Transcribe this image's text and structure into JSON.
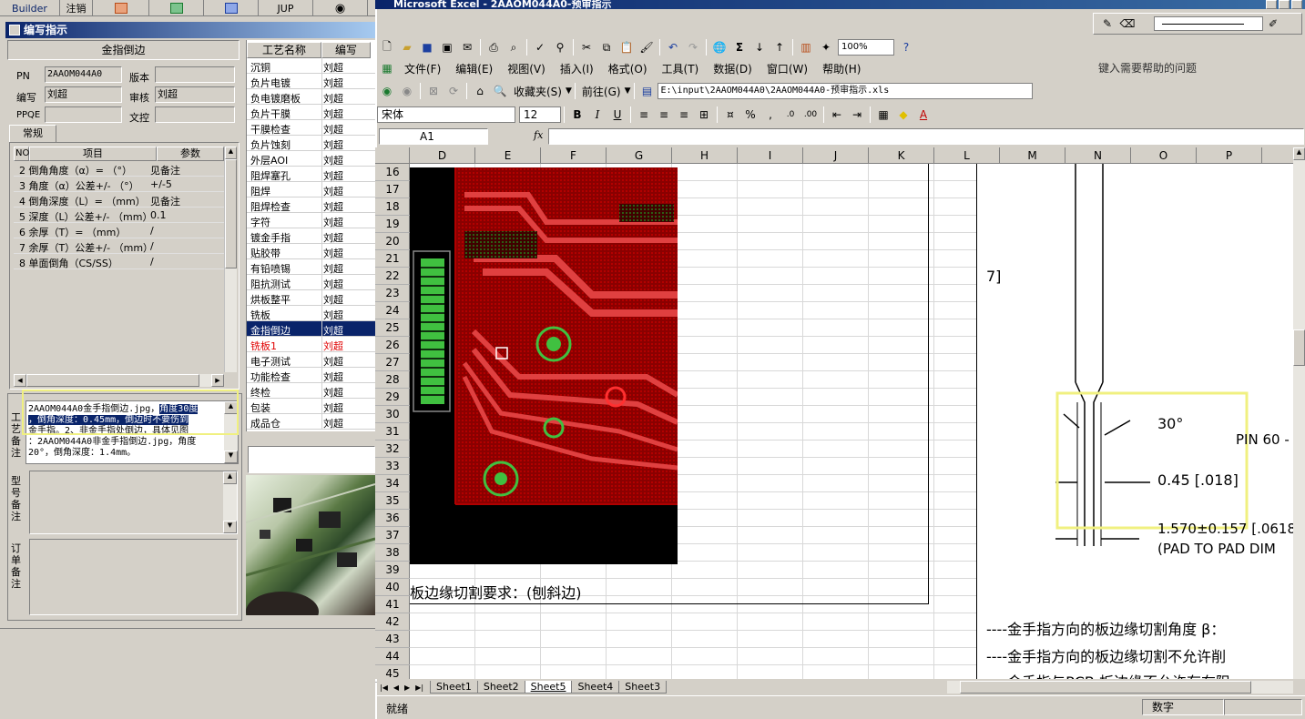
{
  "app_toolbar": {
    "builder": "Builder",
    "logout": "注销",
    "jup": "JUP"
  },
  "dialog": {
    "title": "编写指示",
    "section_title": "金指倒边",
    "labels": {
      "pn": "PN",
      "version": "版本",
      "writer": "编写",
      "reviewer": "审核",
      "ppqe": "PPQE",
      "docctrl": "文控"
    },
    "values": {
      "pn": "2AAOM044A0",
      "version": "",
      "writer": "刘超",
      "reviewer": "刘超",
      "ppqe": "",
      "docctrl": ""
    },
    "tab": "常规",
    "param_headers": [
      "NO",
      "项目",
      "参数"
    ],
    "params": [
      {
        "item": "2 倒角角度（α）=  （°）",
        "value": "见备注"
      },
      {
        "item": "3 角度（α）公差+/-  （°）",
        "value": "+/-5"
      },
      {
        "item": "4 倒角深度（L）=  （mm）",
        "value": "见备注"
      },
      {
        "item": "5 深度（L）公差+/-  （mm）",
        "value": "0.1"
      },
      {
        "item": "6 余厚（T）=  （mm）",
        "value": "/"
      },
      {
        "item": "7 余厚（T）公差+/-  （mm）",
        "value": "/"
      },
      {
        "item": "8 单面倒角（CS/SS）",
        "value": "/"
      }
    ],
    "note_labels": {
      "process": "工艺备注",
      "model": "型号备注",
      "order": "订单备注"
    },
    "process_note": {
      "sel1": "2AAOM044A0金手指倒边.jpg，",
      "sel2": "角度30度",
      "sel3": "，倒角深度：0.45mm，",
      "sel4": "倒边时不要伤到",
      "line3": "金手指。2、非金手指处倒边，具体见图",
      "line4": "：2AAOM044A0非金手指倒边.jpg，角度",
      "line5": "20°，倒角深度：1.4mm。"
    }
  },
  "process_list": {
    "headers": [
      "工艺名称",
      "编写"
    ],
    "rows": [
      {
        "name": "沉铜",
        "writer": "刘超"
      },
      {
        "name": "负片电镀",
        "writer": "刘超"
      },
      {
        "name": "负电镀磨板",
        "writer": "刘超"
      },
      {
        "name": "负片干膜",
        "writer": "刘超"
      },
      {
        "name": "干膜检查",
        "writer": "刘超"
      },
      {
        "name": "负片蚀刻",
        "writer": "刘超"
      },
      {
        "name": "外层AOI",
        "writer": "刘超"
      },
      {
        "name": "阻焊塞孔",
        "writer": "刘超"
      },
      {
        "name": "阻焊",
        "writer": "刘超"
      },
      {
        "name": "阻焊检查",
        "writer": "刘超"
      },
      {
        "name": "字符",
        "writer": "刘超"
      },
      {
        "name": "镀金手指",
        "writer": "刘超"
      },
      {
        "name": "贴胶带",
        "writer": "刘超"
      },
      {
        "name": "有铅喷锡",
        "writer": "刘超"
      },
      {
        "name": "阻抗测试",
        "writer": "刘超"
      },
      {
        "name": "烘板整平",
        "writer": "刘超"
      },
      {
        "name": "铣板",
        "writer": "刘超"
      },
      {
        "name": "金指倒边",
        "writer": "刘超"
      },
      {
        "name": "铣板1",
        "writer": "刘超"
      },
      {
        "name": "电子测试",
        "writer": "刘超"
      },
      {
        "name": "功能检查",
        "writer": "刘超"
      },
      {
        "name": "终检",
        "writer": "刘超"
      },
      {
        "name": "包装",
        "writer": "刘超"
      },
      {
        "name": "成品仓",
        "writer": "刘超"
      }
    ],
    "selected_index": 17,
    "red_index": 18
  },
  "excel": {
    "title": "Microsoft Excel - 2AAOM044A0-预审指示",
    "zoom": "100%",
    "menu": [
      "文件(F)",
      "编辑(E)",
      "视图(V)",
      "插入(I)",
      "格式(O)",
      "工具(T)",
      "数据(D)",
      "窗口(W)",
      "帮助(H)"
    ],
    "help_placeholder": "键入需要帮助的问题",
    "favorites": "收藏夹(S)",
    "goto": "前往(G)",
    "path": "E:\\input\\2AAOM044A0\\2AAOM044A0-预审指示.xls",
    "font": "宋体",
    "font_size": "12",
    "name_box": "A1",
    "fx": "fx",
    "columns": [
      "D",
      "E",
      "F",
      "G",
      "H",
      "I",
      "J",
      "K",
      "L",
      "M",
      "N",
      "O",
      "P"
    ],
    "rows": [
      "16",
      "17",
      "18",
      "19",
      "20",
      "21",
      "22",
      "23",
      "24",
      "25",
      "26",
      "27",
      "28",
      "29",
      "30",
      "31",
      "32",
      "33",
      "34",
      "35",
      "36",
      "37",
      "38",
      "39",
      "40",
      "41",
      "42",
      "43",
      "44",
      "45"
    ],
    "sheets": [
      "Sheet1",
      "Sheet2",
      "Sheet5",
      "Sheet4",
      "Sheet3"
    ],
    "active_sheet": "Sheet5",
    "status_left": "就绪",
    "status_right": "数字",
    "cell_text_40": "板边缘切割要求：(刨斜边)",
    "drawing": {
      "bracket": "7]",
      "angle": "30°",
      "depth": "0.45 [.018]",
      "pin": "PIN 60 -",
      "dim": "1.570±0.157 [.0618",
      "pad": "(PAD TO PAD DIM"
    },
    "text_lines": [
      "----金手指方向的板边缘切割角度 β：",
      "----金手指方向的板边缘切割不允许削",
      "----金手指与PCB 板边缘不允许存在阻"
    ]
  }
}
